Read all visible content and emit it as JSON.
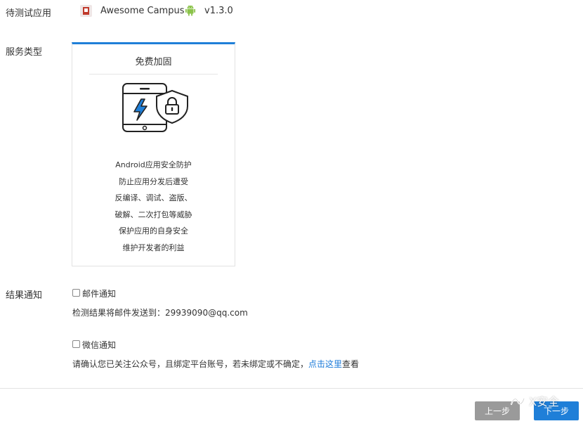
{
  "rows": {
    "app_label": "待测试应用",
    "service_label": "服务类型",
    "notify_label": "结果通知"
  },
  "app": {
    "name": "Awesome Campus",
    "version": "v1.3.0",
    "icon": "app-logo-icon",
    "platform_icon": "android-icon",
    "platform_color": "#8bc34a"
  },
  "service_card": {
    "title": "免费加固",
    "illustration": "phone-shield-lock-icon",
    "accent_color": "#1f7fd8",
    "description": [
      "Android应用安全防护",
      "防止应用分发后遭受",
      "反编译、调试、盗版、",
      "破解、二次打包等威胁",
      "保护应用的自身安全",
      "维护开发者的利益"
    ]
  },
  "notifications": {
    "email": {
      "label": "邮件通知",
      "checked": false,
      "hint": "检测结果将邮件发送到：29939090@qq.com"
    },
    "wechat": {
      "label": "微信通知",
      "checked": false,
      "hint_prefix": "请确认您已关注公众号，且绑定平台账号，若未绑定或不确定，",
      "link_text": "点击这里",
      "hint_suffix": "查看"
    }
  },
  "buttons": {
    "prev": "上一步",
    "next": "下一步"
  },
  "watermark": {
    "text": "X安全",
    "icon": "wechat-channel-icon"
  }
}
